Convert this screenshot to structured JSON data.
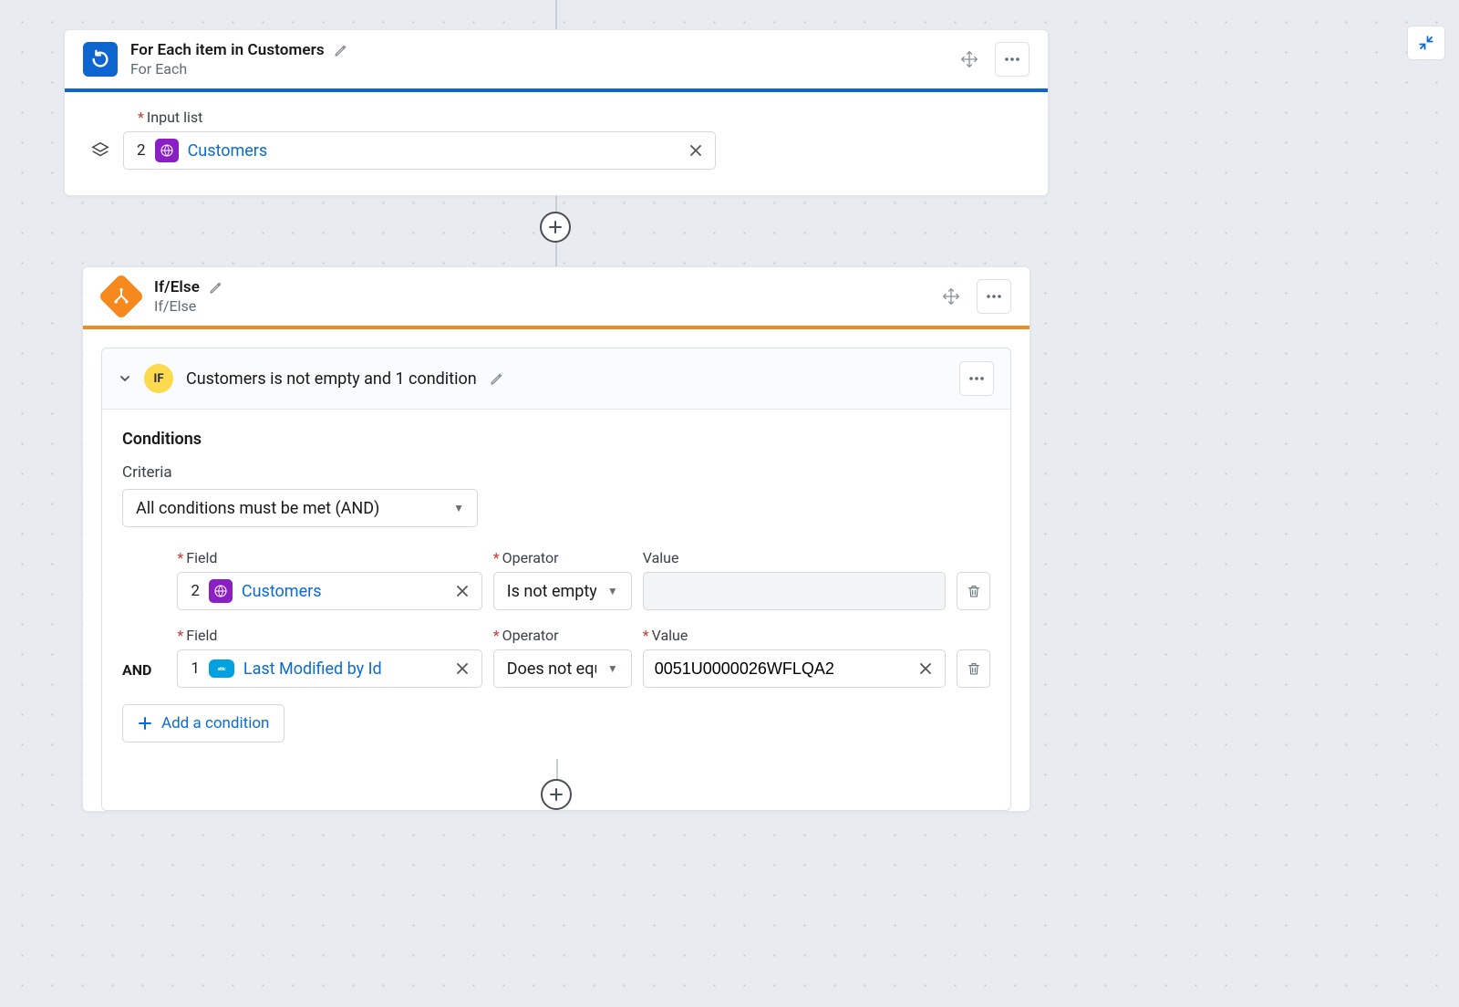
{
  "foreach": {
    "title": "For Each item in Customers",
    "subtitle": "For Each",
    "input_list_label": "Input list",
    "input_list_step": "2",
    "input_list_value": "Customers"
  },
  "ifelse": {
    "title": "If/Else",
    "subtitle": "If/Else",
    "branch": {
      "badge": "IF",
      "summary": "Customers is not empty and 1 condition",
      "conditions_heading": "Conditions",
      "criteria_label": "Criteria",
      "criteria_value": "All conditions must be met (AND)",
      "labels": {
        "field": "Field",
        "operator": "Operator",
        "value": "Value",
        "and": "AND"
      },
      "rows": [
        {
          "join": "",
          "field_step": "2",
          "field_icon": "grid-purple",
          "field_text": "Customers",
          "operator": "Is not empty",
          "value": "",
          "value_required": false,
          "value_disabled": true
        },
        {
          "join": "AND",
          "field_step": "1",
          "field_icon": "sfdc",
          "field_text": "Last Modified by Id",
          "operator": "Does not equal",
          "operator_display": "Does not equ",
          "value": "0051U0000026WFLQA2",
          "value_required": true,
          "value_disabled": false
        }
      ],
      "add_condition": "Add a condition"
    }
  }
}
